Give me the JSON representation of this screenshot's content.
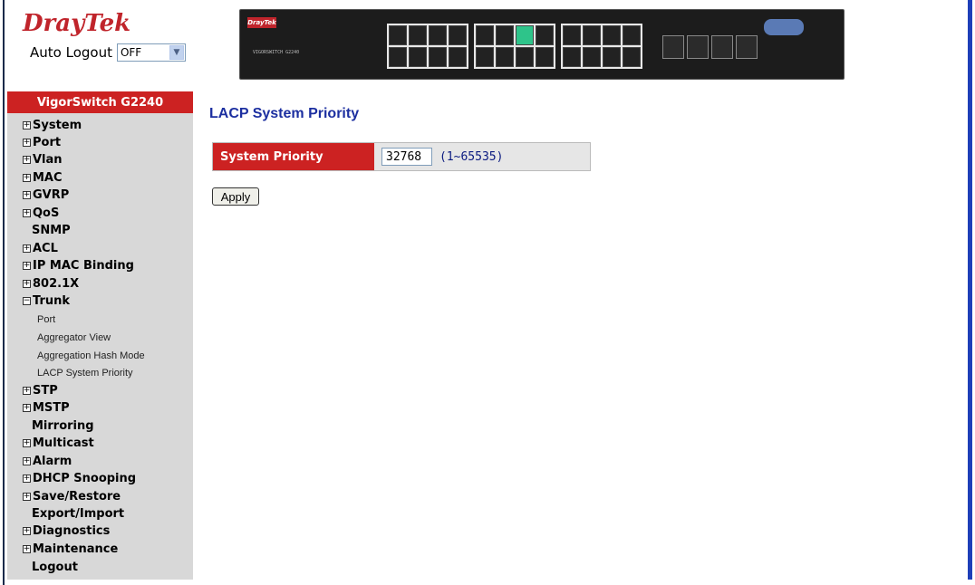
{
  "header": {
    "logo_brand": "Dray",
    "logo_tek": "Tek",
    "auto_logout_label": "Auto Logout",
    "auto_logout_value": "OFF",
    "device_brand": "DrayTek",
    "device_model": "VIGORSWITCH G2240"
  },
  "sidebar": {
    "title": "VigorSwitch G2240",
    "items": [
      {
        "label": "System",
        "expand": "+"
      },
      {
        "label": "Port",
        "expand": "+"
      },
      {
        "label": "Vlan",
        "expand": "+"
      },
      {
        "label": "MAC",
        "expand": "+"
      },
      {
        "label": "GVRP",
        "expand": "+"
      },
      {
        "label": "QoS",
        "expand": "+"
      },
      {
        "label": "SNMP",
        "expand": ""
      },
      {
        "label": "ACL",
        "expand": "+"
      },
      {
        "label": "IP MAC Binding",
        "expand": "+"
      },
      {
        "label": "802.1X",
        "expand": "+"
      },
      {
        "label": "Trunk",
        "expand": "−"
      },
      {
        "label": "STP",
        "expand": "+"
      },
      {
        "label": "MSTP",
        "expand": "+"
      },
      {
        "label": "Mirroring",
        "expand": ""
      },
      {
        "label": "Multicast",
        "expand": "+"
      },
      {
        "label": "Alarm",
        "expand": "+"
      },
      {
        "label": "DHCP Snooping",
        "expand": "+"
      },
      {
        "label": "Save/Restore",
        "expand": "+"
      },
      {
        "label": "Export/Import",
        "expand": ""
      },
      {
        "label": "Diagnostics",
        "expand": "+"
      },
      {
        "label": "Maintenance",
        "expand": "+"
      },
      {
        "label": "Logout",
        "expand": ""
      }
    ],
    "trunk_sub": [
      "Port",
      "Aggregator View",
      "Aggregation Hash Mode",
      "LACP System Priority"
    ]
  },
  "main": {
    "title": "LACP System Priority",
    "priority_label": "System Priority",
    "priority_value": "32768",
    "priority_range": "(1~65535)",
    "apply_label": "Apply"
  },
  "colors": {
    "accent_red": "#cc2222",
    "title_blue": "#1c2fa0",
    "sidebar_bg": "#d8d8d8"
  }
}
